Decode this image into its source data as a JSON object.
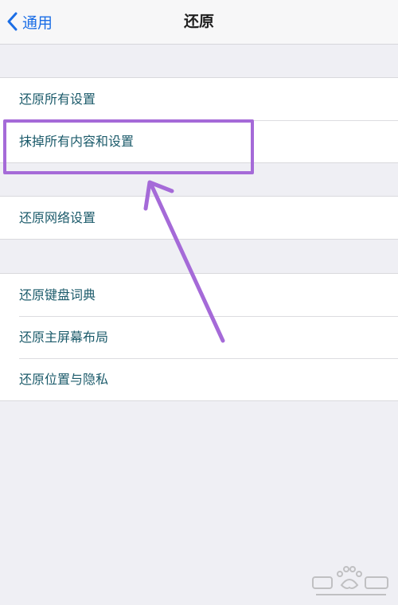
{
  "navbar": {
    "back_label": "通用",
    "title": "还原"
  },
  "groups": [
    {
      "items": [
        {
          "label": "还原所有设置"
        },
        {
          "label": "抹掉所有内容和设置"
        }
      ]
    },
    {
      "items": [
        {
          "label": "还原网络设置"
        }
      ]
    },
    {
      "items": [
        {
          "label": "还原键盘词典"
        },
        {
          "label": "还原主屏幕布局"
        },
        {
          "label": "还原位置与隐私"
        }
      ]
    }
  ],
  "annotation": {
    "color": "#a56ad8",
    "highlighted_item": "抹掉所有内容和设置"
  },
  "colors": {
    "accent": "#1b6ee6",
    "background": "#efeff4",
    "row_text": "#1c5b6b"
  }
}
